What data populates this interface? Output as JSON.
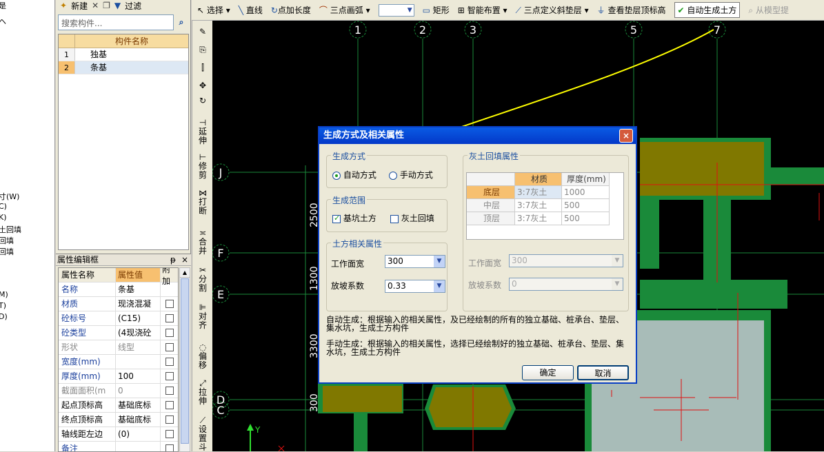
{
  "left_tree": {
    "items": [
      "是",
      "ヘ",
      "寸(W)",
      "C)",
      "K)",
      "土回填",
      "回填",
      "回填",
      "M)",
      "T)",
      "D)"
    ]
  },
  "component_panel": {
    "toolbar": {
      "new_label": "新建",
      "filter_label": "过滤"
    },
    "search_placeholder": "搜索构件...",
    "header": "构件名称",
    "rows": [
      {
        "num": "1",
        "name": "独基"
      },
      {
        "num": "2",
        "name": "条基"
      }
    ]
  },
  "property_panel": {
    "title": "属性编辑框",
    "pin": "ᵽ",
    "close": "×",
    "headers": {
      "name": "属性名称",
      "value": "属性值",
      "extra": "附加"
    },
    "rows": [
      {
        "name": "名称",
        "value": "条基"
      },
      {
        "name": "材质",
        "value": "现浇混凝"
      },
      {
        "name": "砼标号",
        "value": "(C15)"
      },
      {
        "name": "砼类型",
        "value": "(4现浇砼"
      },
      {
        "name": "形状",
        "value": "线型"
      },
      {
        "name": "宽度(mm)",
        "value": ""
      },
      {
        "name": "厚度(mm)",
        "value": "100"
      },
      {
        "name": "截面面积(m",
        "value": "0"
      },
      {
        "name": "起点顶标高",
        "value": "基础底标"
      },
      {
        "name": "终点顶标高",
        "value": "基础底标"
      },
      {
        "name": "轴线距左边",
        "value": "(0)"
      },
      {
        "name": "备注",
        "value": ""
      }
    ]
  },
  "top_toolbar": {
    "items": [
      "选择",
      "直线",
      "点加长度",
      "三点画弧",
      "矩形",
      "智能布置",
      "三点定义斜垫层",
      "查看垫层顶标高",
      "自动生成土方",
      "从模型提"
    ]
  },
  "vertical_toolbar": {
    "items": [
      "延伸",
      "修剪",
      "打断",
      "合并",
      "分割",
      "对齐",
      "偏移",
      "拉伸",
      "设置斗"
    ]
  },
  "axis_labels": {
    "top": [
      "1",
      "2",
      "3",
      "5",
      "7"
    ],
    "left": [
      "J",
      "F",
      "E",
      "D",
      "C"
    ],
    "dimensions": [
      "2500",
      "1300",
      "3300",
      "300"
    ],
    "y_axis": "Y"
  },
  "dialog": {
    "title": "生成方式及相关属性",
    "close": "×",
    "mode_group": {
      "label": "生成方式",
      "auto": "自动方式",
      "manual": "手动方式",
      "selected": "auto"
    },
    "range_group": {
      "label": "生成范围",
      "pit": "基坑土方",
      "backfill": "灰土回填",
      "pit_checked": true,
      "backfill_checked": false
    },
    "earth_group": {
      "label": "土方相关属性",
      "width_label": "工作面宽",
      "width_value": "300",
      "slope_label": "放坡系数",
      "slope_value": "0.33"
    },
    "backfill_group": {
      "label": "灰土回填属性",
      "headers": [
        "材质",
        "厚度(mm)"
      ],
      "rows": [
        {
          "layer": "底层",
          "material": "3:7灰土",
          "thickness": "1000"
        },
        {
          "layer": "中层",
          "material": "3:7灰土",
          "thickness": "500"
        },
        {
          "layer": "顶层",
          "material": "3:7灰土",
          "thickness": "500"
        }
      ],
      "width_label": "工作面宽",
      "width_value": "300",
      "slope_label": "放坡系数",
      "slope_value": "0"
    },
    "auto_desc": "自动生成：根据输入的相关属性，及已经绘制的所有的独立基础、桩承台、垫层、集水坑，生成土方构件",
    "manual_desc": "手动生成：根据输入的相关属性，选择已经绘制好的独立基础、桩承台、垫层、集水坑，生成土方构件",
    "ok": "确定",
    "cancel": "取消"
  },
  "colors": {
    "canvas": "#000000",
    "footing": "#807800",
    "beam": "#1a8a3a",
    "axis": "#1a8a3a",
    "dialog_title": "#0a46d8",
    "pale_pad": "#a8bcb8",
    "arrow": "#ffff00"
  }
}
